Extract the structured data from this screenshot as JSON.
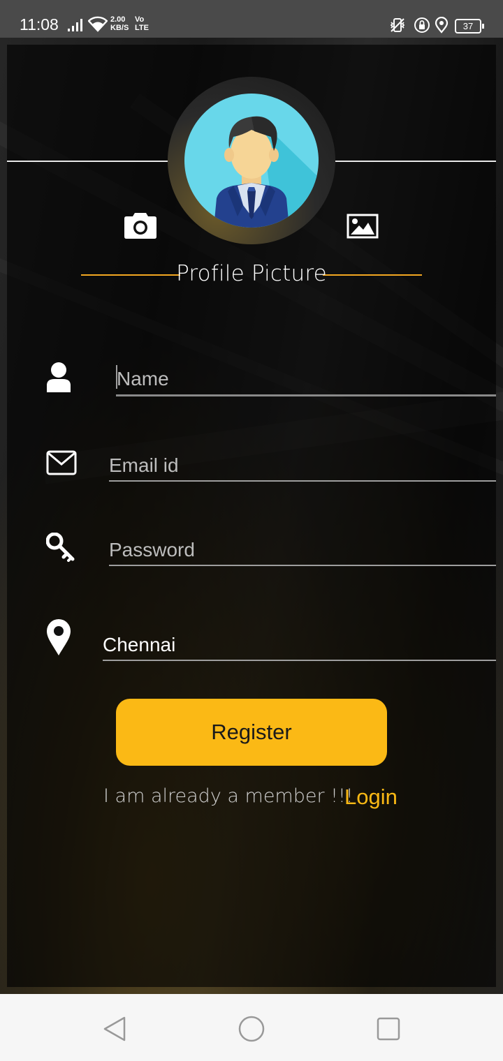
{
  "status_bar": {
    "time": "11:08",
    "net_speed_value": "2.00",
    "net_speed_unit": "KB/S",
    "vo_label": "Vo",
    "lte_label": "LTE",
    "battery_level": "37"
  },
  "profile": {
    "label": "Profile Picture",
    "camera_icon": "camera-icon",
    "gallery_icon": "image-icon"
  },
  "form": {
    "name_placeholder": "Name",
    "email_placeholder": "Email id",
    "password_placeholder": "Password",
    "location_value": "Chennai"
  },
  "actions": {
    "register_label": "Register",
    "member_text": "I am already a member !!!",
    "login_label": "Login"
  },
  "colors": {
    "accent": "#fbb915",
    "avatar_bg": "#68d7ea",
    "divider_orange": "#f3a721"
  }
}
